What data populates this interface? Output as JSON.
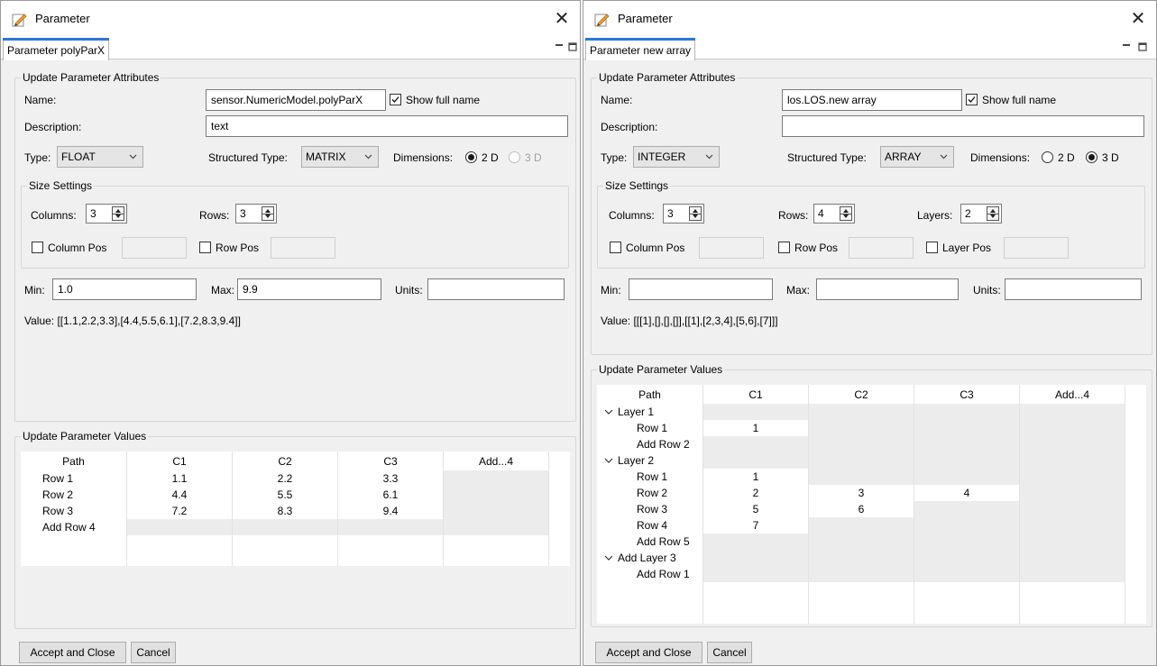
{
  "left": {
    "title": "Parameter",
    "tab": "Parameter polyParX",
    "attributes_group": "Update Parameter Attributes",
    "name_label": "Name:",
    "name_value": "sensor.NumericModel.polyParX",
    "show_full_name": "Show full name",
    "description_label": "Description:",
    "description_value": "text",
    "type_label": "Type:",
    "type_value": "FLOAT",
    "structured_type_label": "Structured Type:",
    "structured_type_value": "MATRIX",
    "dimensions_label": "Dimensions:",
    "dim_2d": "2 D",
    "dim_3d": "3 D",
    "size_group": "Size Settings",
    "columns_label": "Columns:",
    "columns_value": "3",
    "rows_label": "Rows:",
    "rows_value": "3",
    "column_pos": "Column Pos",
    "row_pos": "Row Pos",
    "min_label": "Min:",
    "min_value": "1.0",
    "max_label": "Max:",
    "max_value": "9.9",
    "units_label": "Units:",
    "units_value": "",
    "value_text": "Value: [[1.1,2.2,3.3],[4.4,5.5,6.1],[7.2,8.3,9.4]]",
    "values_group": "Update Parameter Values",
    "table": {
      "headers": [
        "Path",
        "C1",
        "C2",
        "C3",
        "Add...4"
      ],
      "rows": [
        [
          "Row 1",
          "1.1",
          "2.2",
          "3.3",
          ""
        ],
        [
          "Row 2",
          "4.4",
          "5.5",
          "6.1",
          ""
        ],
        [
          "Row 3",
          "7.2",
          "8.3",
          "9.4",
          ""
        ],
        [
          "Add Row 4",
          "",
          "",
          "",
          ""
        ]
      ]
    },
    "accept_button": "Accept and Close",
    "cancel_button": "Cancel"
  },
  "right": {
    "title": "Parameter",
    "tab": "Parameter new array",
    "attributes_group": "Update Parameter Attributes",
    "name_label": "Name:",
    "name_value": "los.LOS.new array",
    "show_full_name": "Show full name",
    "description_label": "Description:",
    "description_value": "",
    "type_label": "Type:",
    "type_value": "INTEGER",
    "structured_type_label": "Structured Type:",
    "structured_type_value": "ARRAY",
    "dimensions_label": "Dimensions:",
    "dim_2d": "2 D",
    "dim_3d": "3 D",
    "size_group": "Size Settings",
    "columns_label": "Columns:",
    "columns_value": "3",
    "rows_label": "Rows:",
    "rows_value": "4",
    "layers_label": "Layers:",
    "layers_value": "2",
    "column_pos": "Column Pos",
    "row_pos": "Row Pos",
    "layer_pos": "Layer Pos",
    "min_label": "Min:",
    "min_value": "",
    "max_label": "Max:",
    "max_value": "",
    "units_label": "Units:",
    "units_value": "",
    "value_text": "Value: [[[1],[],[],[]],[[1],[2,3,4],[5,6],[7]]]",
    "values_group": "Update Parameter Values",
    "table": {
      "headers": [
        "Path",
        "C1",
        "C2",
        "C3",
        "Add...4"
      ],
      "rows": [
        {
          "path": "Layer 1",
          "layer": true,
          "cells": [
            "",
            "",
            "",
            ""
          ]
        },
        {
          "path": "Row 1",
          "layer": false,
          "cells": [
            "1",
            "",
            "",
            ""
          ]
        },
        {
          "path": "Add Row 2",
          "layer": false,
          "cells": [
            "",
            "",
            "",
            ""
          ]
        },
        {
          "path": "Layer 2",
          "layer": true,
          "cells": [
            "",
            "",
            "",
            ""
          ]
        },
        {
          "path": "Row 1",
          "layer": false,
          "cells": [
            "1",
            "",
            "",
            ""
          ]
        },
        {
          "path": "Row 2",
          "layer": false,
          "cells": [
            "2",
            "3",
            "4",
            ""
          ]
        },
        {
          "path": "Row 3",
          "layer": false,
          "cells": [
            "5",
            "6",
            "",
            ""
          ]
        },
        {
          "path": "Row 4",
          "layer": false,
          "cells": [
            "7",
            "",
            "",
            ""
          ]
        },
        {
          "path": "Add Row 5",
          "layer": false,
          "cells": [
            "",
            "",
            "",
            ""
          ]
        },
        {
          "path": "Add Layer 3",
          "layer": true,
          "cells": [
            "",
            "",
            "",
            ""
          ]
        },
        {
          "path": "Add Row 1",
          "layer": false,
          "cells": [
            "",
            "",
            "",
            ""
          ]
        }
      ]
    },
    "accept_button": "Accept and Close",
    "cancel_button": "Cancel"
  }
}
